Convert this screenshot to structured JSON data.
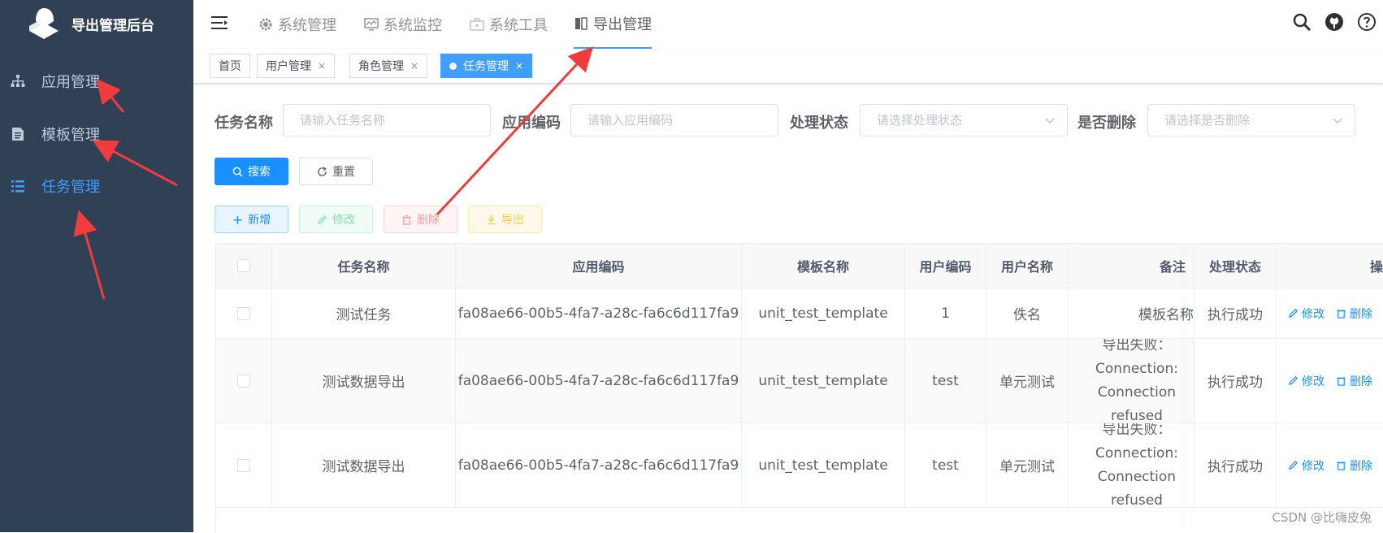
{
  "app": {
    "title": "导出管理后台"
  },
  "sidebar": {
    "items": [
      {
        "label": "应用管理",
        "icon": "sitemap-icon"
      },
      {
        "label": "模板管理",
        "icon": "document-icon"
      },
      {
        "label": "任务管理",
        "icon": "list-icon",
        "active": true
      }
    ]
  },
  "topnav": {
    "items": [
      {
        "label": "系统管理",
        "icon": "gear-icon"
      },
      {
        "label": "系统监控",
        "icon": "monitor-icon"
      },
      {
        "label": "系统工具",
        "icon": "toolbox-icon"
      },
      {
        "label": "导出管理",
        "icon": "book-icon",
        "active": true
      }
    ],
    "right_icons": [
      "search-icon",
      "github-icon",
      "help-icon"
    ]
  },
  "tags": [
    {
      "label": "首页",
      "closable": false
    },
    {
      "label": "用户管理",
      "closable": true
    },
    {
      "label": "角色管理",
      "closable": true
    },
    {
      "label": "任务管理",
      "closable": true,
      "active": true
    }
  ],
  "tag_close_glyph": "×",
  "search": {
    "task_name": {
      "label": "任务名称",
      "placeholder": "请输入任务名称"
    },
    "app_code": {
      "label": "应用编码",
      "placeholder": "请输入应用编码"
    },
    "status": {
      "label": "处理状态",
      "placeholder": "请选择处理状态"
    },
    "deleted": {
      "label": "是否删除",
      "placeholder": "请选择是否删除"
    },
    "search_btn": "搜索",
    "reset_btn": "重置"
  },
  "toolbar": {
    "add": "新增",
    "edit": "修改",
    "delete": "删除",
    "export": "导出"
  },
  "table": {
    "headers": [
      "任务名称",
      "应用编码",
      "模板名称",
      "用户编码",
      "用户名称",
      "备注",
      "处理状态",
      "操"
    ],
    "rows": [
      {
        "task": "测试任务",
        "app": "fa08ae66-00b5-4fa7-a28c-fa6c6d117fa9",
        "template": "unit_test_template",
        "user_code": "1",
        "user_name": "佚名",
        "remark": "模板名称",
        "status": "执行成功"
      },
      {
        "task": "测试数据导出",
        "app": "fa08ae66-00b5-4fa7-a28c-fa6c6d117fa9",
        "template": "unit_test_template",
        "user_code": "test",
        "user_name": "单元测试",
        "remark": "导出失败：Connection: Connection refused",
        "status": "执行成功"
      },
      {
        "task": "测试数据导出",
        "app": "fa08ae66-00b5-4fa7-a28c-fa6c6d117fa9",
        "template": "unit_test_template",
        "user_code": "test",
        "user_name": "单元测试",
        "remark": "导出失败：Connection: Connection refused",
        "status": "执行成功"
      }
    ],
    "op_edit": "修改",
    "op_delete": "删除"
  },
  "watermark": "CSDN @比嗨皮兔",
  "colors": {
    "sidebar_bg": "#304156",
    "primary": "#1890ff",
    "annotation_arrow": "#f03c3c"
  }
}
